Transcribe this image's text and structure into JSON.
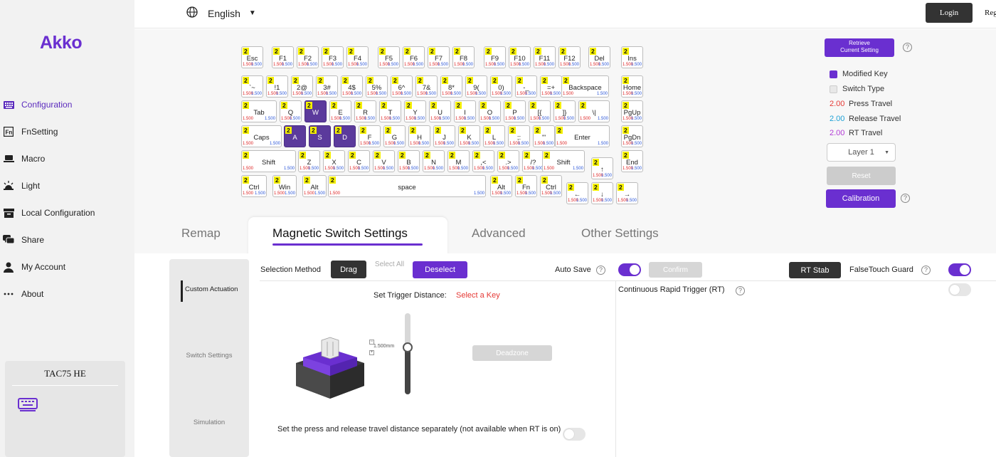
{
  "sidebar": {
    "logo": "Akko",
    "items": [
      {
        "label": "Configuration",
        "icon": "keyboard-config-icon"
      },
      {
        "label": "FnSetting",
        "icon": "fn-icon"
      },
      {
        "label": "Macro",
        "icon": "macro-icon"
      },
      {
        "label": "Light",
        "icon": "light-icon"
      },
      {
        "label": "Local Configuration",
        "icon": "local-config-icon"
      },
      {
        "label": "Share",
        "icon": "share-icon"
      },
      {
        "label": "My Account",
        "icon": "account-icon"
      },
      {
        "label": "About",
        "icon": "more-icon"
      }
    ],
    "device_name": "TAC75 HE"
  },
  "topbar": {
    "language": "English",
    "login": "Login",
    "register": "Reg"
  },
  "keyboard": {
    "layer_tag": "2",
    "press_value": "1.500",
    "release_value": "1.500",
    "rows": [
      [
        "Esc",
        "F1",
        "F2",
        "F3",
        "F4",
        "F5",
        "F6",
        "F7",
        "F8",
        "F9",
        "F10",
        "F11",
        "F12",
        "Del",
        "Ins"
      ],
      [
        "`~",
        "!1",
        "2@",
        "3#",
        "4$",
        "5%",
        "6^",
        "7&",
        "8*",
        "9(",
        "0)",
        "-_",
        "=+",
        "Backspace",
        "Home"
      ],
      [
        "Tab",
        "Q",
        "W",
        "E",
        "R",
        "T",
        "Y",
        "U",
        "I",
        "O",
        "P",
        "[{",
        "]}",
        "\\|",
        "PgUp"
      ],
      [
        "Caps",
        "A",
        "S",
        "D",
        "F",
        "G",
        "H",
        "J",
        "K",
        "L",
        ";:",
        "'\"",
        "Enter",
        "PgDn"
      ],
      [
        "Shift",
        "Z",
        "X",
        "C",
        "V",
        "B",
        "N",
        "M",
        ",<",
        ".>",
        "/?",
        "Shift",
        "↑",
        "End"
      ],
      [
        "Ctrl",
        "Win",
        "Alt",
        "space",
        "Alt",
        "Fn",
        "Ctrl",
        "←",
        "↓",
        "→"
      ]
    ],
    "selected_keys": [
      "W",
      "A",
      "S",
      "D"
    ]
  },
  "right_panel": {
    "retrieve_line1": "Retrieve",
    "retrieve_line2": "Current Setting",
    "legend_modified": "Modified Key",
    "legend_switch": "Switch Type",
    "press_travel_value": "2.00",
    "press_travel_label": "Press Travel",
    "release_travel_value": "2.00",
    "release_travel_label": "Release Travel",
    "rt_travel_value": "2.00",
    "rt_travel_label": "RT Travel",
    "layer": "Layer 1",
    "reset": "Reset",
    "calibration": "Calibration",
    "colors": {
      "modified": "#6a2fd0",
      "press": "#e53935",
      "release": "#1ea1d6",
      "rt": "#b23ad6"
    }
  },
  "tabs": [
    "Remap",
    "Magnetic Switch Settings",
    "Advanced",
    "Other Settings"
  ],
  "side_menu": [
    "Custom Actuation",
    "Switch Settings",
    "Simulation"
  ],
  "settings": {
    "selection_method_label": "Selection Method",
    "drag": "Drag",
    "select_all": "Select All",
    "deselect": "Deselect",
    "auto_save_label": "Auto Save",
    "auto_save_on": true,
    "confirm": "Confirm",
    "rt_stab": "RT Stab",
    "falsetouch_label": "FalseTouch Guard",
    "falsetouch_on": true,
    "trigger_label": "Set Trigger Distance:",
    "trigger_hint": "Select a Key",
    "slider_value": "1.500mm",
    "deadzone": "Deadzone",
    "separate_text": "Set the press and release travel distance separately (not available when RT is on)",
    "separate_on": false,
    "crt_label": "Continuous Rapid Trigger (RT)",
    "crt_on": false
  }
}
